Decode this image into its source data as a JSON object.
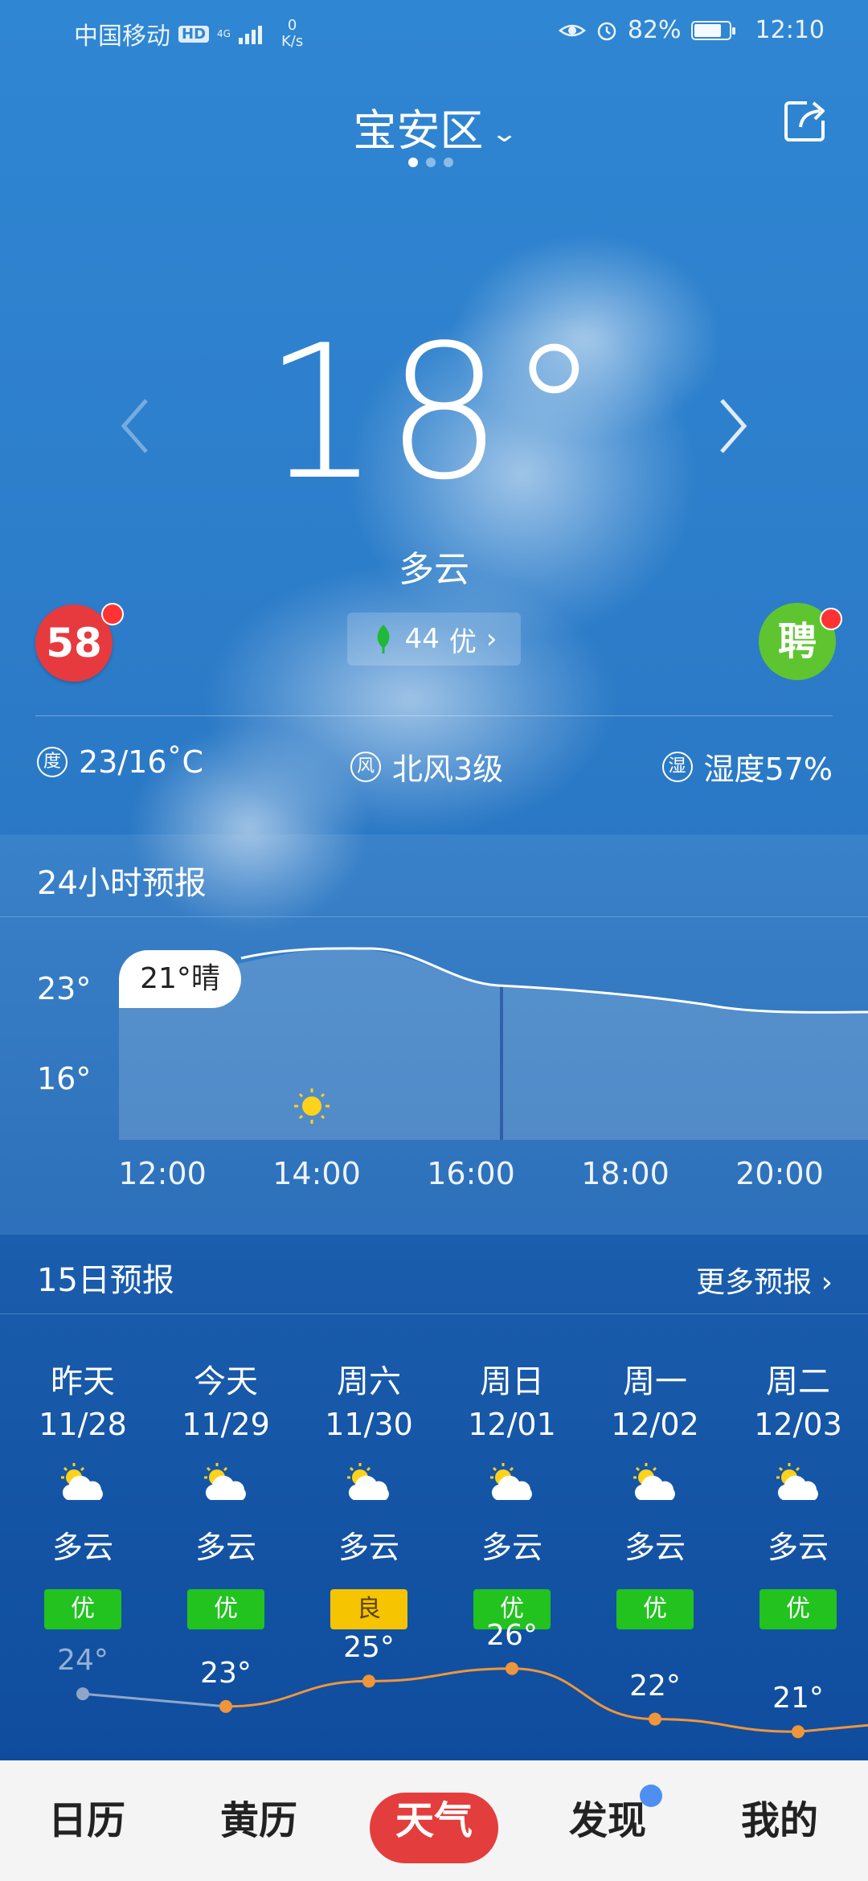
{
  "status_bar": {
    "carrier": "中国移动",
    "hd": "HD",
    "network_type": "4G",
    "speed_value": "0",
    "speed_unit": "K/s",
    "battery": "82%",
    "battery_level": 0.82,
    "time": "12:10"
  },
  "header": {
    "city": "宝安区",
    "page_count": 3,
    "active_page": 0
  },
  "current": {
    "temperature": "18°",
    "condition": "多云",
    "aqi_value": "44",
    "aqi_level": "优",
    "badge_left": "58",
    "badge_right": "聘"
  },
  "details": {
    "temp_icon": "度",
    "temp_range": "23/16˚C",
    "wind_icon": "风",
    "wind": "北风3级",
    "humidity_icon": "湿",
    "humidity": "湿度57%"
  },
  "hourly": {
    "title": "24小时预报",
    "y_high": "23°",
    "y_low": "16°",
    "tooltip": "21°晴",
    "hours": [
      "12:00",
      "14:00",
      "16:00",
      "18:00",
      "20:00"
    ]
  },
  "daily": {
    "title": "15日预报",
    "more": "更多预报",
    "days": [
      {
        "name": "昨天",
        "date": "11/28",
        "cond": "多云",
        "quality": "优",
        "high": "24°"
      },
      {
        "name": "今天",
        "date": "11/29",
        "cond": "多云",
        "quality": "优",
        "high": "23°"
      },
      {
        "name": "周六",
        "date": "11/30",
        "cond": "多云",
        "quality": "良",
        "high": "25°"
      },
      {
        "name": "周日",
        "date": "12/01",
        "cond": "多云",
        "quality": "优",
        "high": "26°"
      },
      {
        "name": "周一",
        "date": "12/02",
        "cond": "多云",
        "quality": "优",
        "high": "22°"
      },
      {
        "name": "周二",
        "date": "12/03",
        "cond": "多云",
        "quality": "优",
        "high": "21°"
      }
    ],
    "quality_colors": {
      "优": "#22c21f",
      "良": "#f6c400"
    },
    "line_color": "#f0963a",
    "past_line_color": "#8fa6c8"
  },
  "nav": {
    "items": [
      "日历",
      "黄历",
      "天气",
      "发现",
      "我的"
    ],
    "active": "天气"
  }
}
